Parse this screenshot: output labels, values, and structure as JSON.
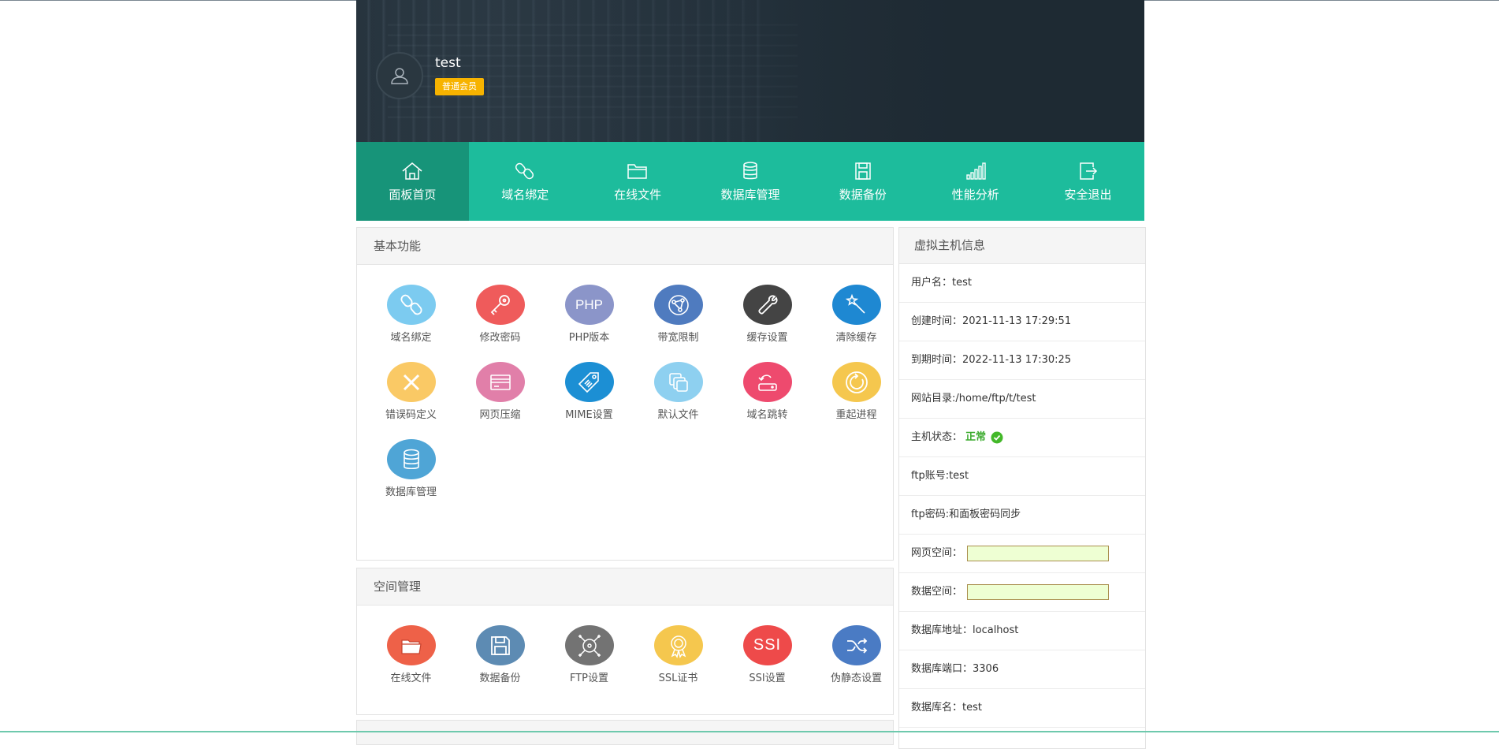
{
  "user": {
    "name": "test",
    "badge": "普通会员"
  },
  "nav": [
    {
      "label": "面板首页",
      "icon": "home-icon"
    },
    {
      "label": "域名绑定",
      "icon": "link-icon"
    },
    {
      "label": "在线文件",
      "icon": "folder-icon"
    },
    {
      "label": "数据库管理",
      "icon": "database-icon"
    },
    {
      "label": "数据备份",
      "icon": "save-icon"
    },
    {
      "label": "性能分析",
      "icon": "signal-bars-icon"
    },
    {
      "label": "安全退出",
      "icon": "logout-icon"
    }
  ],
  "basic": {
    "title": "基本功能",
    "items": [
      {
        "label": "域名绑定",
        "color": "#7ccbf0",
        "icon": "link-icon"
      },
      {
        "label": "修改密码",
        "color": "#ef5b5b",
        "icon": "key-icon"
      },
      {
        "label": "PHP版本",
        "color": "#8b95c9",
        "icon": "php-icon",
        "text": "PHP"
      },
      {
        "label": "带宽限制",
        "color": "#4f7bbf",
        "icon": "network-icon"
      },
      {
        "label": "缓存设置",
        "color": "#444444",
        "icon": "wrench-icon"
      },
      {
        "label": "清除缓存",
        "color": "#1e88d2",
        "icon": "magic-wand-icon"
      },
      {
        "label": "错误码定义",
        "color": "#fac965",
        "icon": "close-icon"
      },
      {
        "label": "网页压缩",
        "color": "#e17fa9",
        "icon": "card-icon"
      },
      {
        "label": "MIME设置",
        "color": "#1c8fd4",
        "icon": "tag-icon"
      },
      {
        "label": "默认文件",
        "color": "#8ed0f0",
        "icon": "copy-icon"
      },
      {
        "label": "域名跳转",
        "color": "#ee4a6e",
        "icon": "redirect-icon"
      },
      {
        "label": "重起进程",
        "color": "#f5c74e",
        "icon": "restart-icon"
      },
      {
        "label": "数据库管理",
        "color": "#4fa5d6",
        "icon": "database-icon"
      }
    ]
  },
  "space": {
    "title": "空间管理",
    "items": [
      {
        "label": "在线文件",
        "color": "#ee6148",
        "icon": "folder-icon"
      },
      {
        "label": "数据备份",
        "color": "#5d8bb3",
        "icon": "save-icon"
      },
      {
        "label": "FTP设置",
        "color": "#737373",
        "icon": "ftp-icon"
      },
      {
        "label": "SSL证书",
        "color": "#f5c74e",
        "icon": "certificate-icon"
      },
      {
        "label": "SSI设置",
        "color": "#ee4a4a",
        "icon": "ssi-icon",
        "text": "SSI"
      },
      {
        "label": "伪静态设置",
        "color": "#4a7bc4",
        "icon": "shuffle-icon"
      }
    ]
  },
  "info": {
    "title": "虚拟主机信息",
    "rows": {
      "username_k": "用户名：",
      "username_v": "test",
      "created_k": "创建时间：",
      "created_v": "2021-11-13 17:29:51",
      "expire_k": "到期时间：",
      "expire_v": "2022-11-13 17:30:25",
      "webdir_k": "网站目录:",
      "webdir_v": "/home/ftp/t/test",
      "status_k": "主机状态：",
      "status_v": "正常",
      "ftpuser_k": "ftp账号:",
      "ftpuser_v": "test",
      "ftppass_k": "ftp密码:",
      "ftppass_v": "和面板密码同步",
      "webspace_k": "网页空间：",
      "dbspace_k": "数据空间：",
      "dbhost_k": "数据库地址：",
      "dbhost_v": "localhost",
      "dbport_k": "数据库端口：",
      "dbport_v": "3306",
      "dbname_k": "数据库名：",
      "dbname_v": "test"
    }
  }
}
